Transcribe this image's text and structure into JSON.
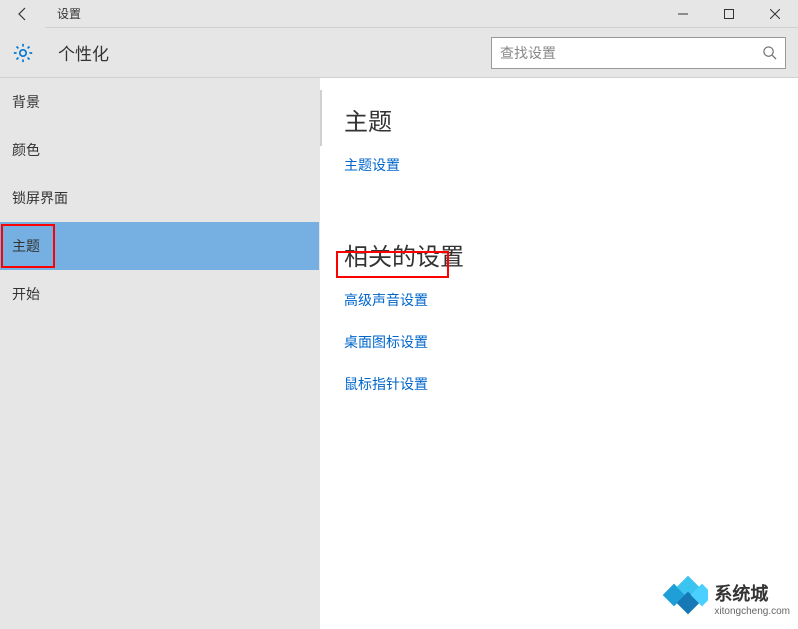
{
  "titlebar": {
    "title": "设置"
  },
  "header": {
    "title": "个性化",
    "search_placeholder": "查找设置"
  },
  "sidebar": {
    "items": [
      {
        "label": "背景"
      },
      {
        "label": "颜色"
      },
      {
        "label": "锁屏界面"
      },
      {
        "label": "主题"
      },
      {
        "label": "开始"
      }
    ]
  },
  "content": {
    "section1_title": "主题",
    "section1_link": "主题设置",
    "section2_title": "相关的设置",
    "section2_links": [
      "高级声音设置",
      "桌面图标设置",
      "鼠标指针设置"
    ]
  },
  "watermark": {
    "title": "系统城",
    "url": "xitongcheng.com"
  }
}
